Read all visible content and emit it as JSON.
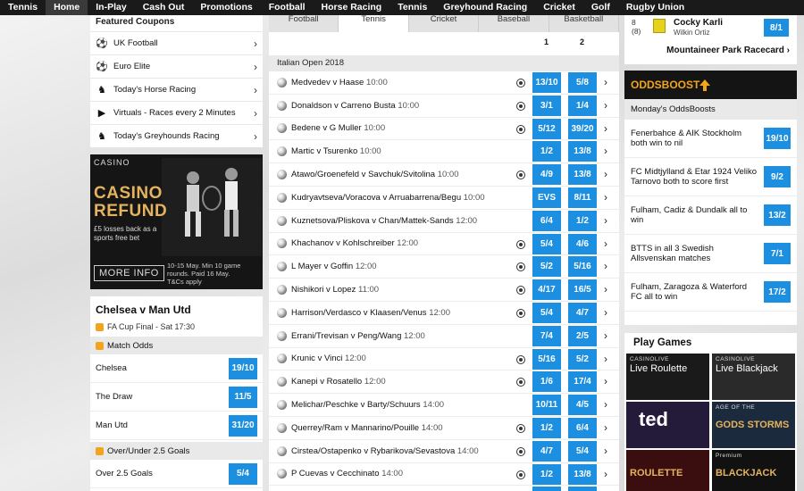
{
  "nav": [
    "Tennis",
    "Home",
    "In-Play",
    "Cash Out",
    "Promotions",
    "Football",
    "Horse Racing",
    "Tennis",
    "Greyhound Racing",
    "Cricket",
    "Golf",
    "Rugby Union"
  ],
  "nav_active": 1,
  "featured": {
    "title": "Featured Coupons",
    "items": [
      {
        "icon": "football-icon",
        "glyph": "⚽",
        "label": "UK Football"
      },
      {
        "icon": "football-icon",
        "glyph": "⚽",
        "label": "Euro Elite"
      },
      {
        "icon": "horse-icon",
        "glyph": "♞",
        "label": "Today's Horse Racing"
      },
      {
        "icon": "virtuals-icon",
        "glyph": "▶",
        "label": "Virtuals - Races every 2 Minutes"
      },
      {
        "icon": "greyhound-icon",
        "glyph": "♞",
        "label": "Today's Greyhounds Racing"
      }
    ]
  },
  "casino_promo": {
    "brand": "CASINO",
    "headline_1": "CASINO",
    "headline_2": "REFUND",
    "subtext": "£5 losses back as a sports free bet",
    "button": "MORE INFO",
    "terms": "10-15 May. Min 10 game rounds. Paid 16 May. T&Cs apply"
  },
  "match": {
    "title": "Chelsea v Man Utd",
    "subtitle": "FA Cup Final - Sat 17:30",
    "odds_title": "Match Odds",
    "rows": [
      {
        "name": "Chelsea",
        "odds": "19/10"
      },
      {
        "name": "The Draw",
        "odds": "11/5"
      },
      {
        "name": "Man Utd",
        "odds": "31/20"
      }
    ],
    "goals_title": "Over/Under 2.5 Goals",
    "goals_rows": [
      {
        "name": "Over 2.5 Goals",
        "odds": "5/4"
      }
    ]
  },
  "sport_tabs": [
    "Football",
    "Tennis",
    "Cricket",
    "Baseball",
    "Basketball"
  ],
  "sport_tab_active": 1,
  "col1": "1",
  "col2": "2",
  "league": "Italian Open 2018",
  "events": [
    {
      "name": "Medvedev v Haase",
      "time": "10:00",
      "live": true,
      "o1": "13/10",
      "o2": "5/8"
    },
    {
      "name": "Donaldson v Carreno Busta",
      "time": "10:00",
      "live": true,
      "o1": "3/1",
      "o2": "1/4"
    },
    {
      "name": "Bedene v G Muller",
      "time": "10:00",
      "live": true,
      "o1": "5/12",
      "o2": "39/20"
    },
    {
      "name": "Martic v Tsurenko",
      "time": "10:00",
      "live": false,
      "o1": "1/2",
      "o2": "13/8"
    },
    {
      "name": "Atawo/Groenefeld v Savchuk/Svitolina",
      "time": "10:00",
      "live": true,
      "o1": "4/9",
      "o2": "13/8"
    },
    {
      "name": "Kudryavtseva/Voracova v Arruabarrena/Begu",
      "time": "10:00",
      "live": false,
      "o1": "EVS",
      "o2": "8/11"
    },
    {
      "name": "Kuznetsova/Pliskova v Chan/Mattek-Sands",
      "time": "12:00",
      "live": false,
      "o1": "6/4",
      "o2": "1/2"
    },
    {
      "name": "Khachanov v Kohlschreiber",
      "time": "12:00",
      "live": true,
      "o1": "5/4",
      "o2": "4/6"
    },
    {
      "name": "L Mayer v Goffin",
      "time": "12:00",
      "live": true,
      "o1": "5/2",
      "o2": "5/16"
    },
    {
      "name": "Nishikori v Lopez",
      "time": "11:00",
      "live": true,
      "o1": "4/17",
      "o2": "16/5"
    },
    {
      "name": "Harrison/Verdasco v Klaasen/Venus",
      "time": "12:00",
      "live": true,
      "o1": "5/4",
      "o2": "4/7"
    },
    {
      "name": "Errani/Trevisan v Peng/Wang",
      "time": "12:00",
      "live": false,
      "o1": "7/4",
      "o2": "2/5"
    },
    {
      "name": "Krunic v Vinci",
      "time": "12:00",
      "live": true,
      "o1": "5/16",
      "o2": "5/2"
    },
    {
      "name": "Kanepi v Rosatello",
      "time": "12:00",
      "live": true,
      "o1": "1/6",
      "o2": "17/4"
    },
    {
      "name": "Melichar/Peschke v Barty/Schuurs",
      "time": "14:00",
      "live": false,
      "o1": "10/11",
      "o2": "4/5"
    },
    {
      "name": "Querrey/Ram v Mannarino/Pouille",
      "time": "14:00",
      "live": true,
      "o1": "1/2",
      "o2": "6/4"
    },
    {
      "name": "Cirstea/Ostapenko v Rybarikova/Sevastova",
      "time": "14:00",
      "live": true,
      "o1": "4/7",
      "o2": "5/4"
    },
    {
      "name": "P Cuevas v Cecchinato",
      "time": "14:00",
      "live": true,
      "o1": "1/2",
      "o2": "13/8"
    },
    {
      "name": "",
      "time": "",
      "live": false,
      "o1": "",
      "o2": ""
    }
  ],
  "race": {
    "number": "8",
    "draw": "(8)",
    "horse": "Cocky Karli",
    "jockey": "Wilkin Ortiz",
    "odds": "8/1",
    "link": "Mountaineer Park Racecard"
  },
  "oddsboost": {
    "t1": "ODDS",
    "t2": "BOOST",
    "subtitle": "Monday's OddsBoosts",
    "items": [
      {
        "desc": "Fenerbahce & AIK Stockholm both win to nil",
        "odds": "19/10"
      },
      {
        "desc": "FC Midtjylland & Etar 1924 Veliko Tarnovo both to score first",
        "odds": "9/2"
      },
      {
        "desc": "Fulham, Cadiz & Dundalk all to win",
        "odds": "13/2"
      },
      {
        "desc": "BTTS in all 3 Swedish Allsvenskan matches",
        "odds": "7/1"
      },
      {
        "desc": "Fulham, Zaragoza & Waterford FC all to win",
        "odds": "17/2"
      }
    ]
  },
  "play_games": {
    "title": "Play Games",
    "tiles": [
      {
        "small": "CASINOLIVE",
        "big": "Live Roulette",
        "bg": "#1a1a1a"
      },
      {
        "small": "CASINOLIVE",
        "big": "Live Blackjack",
        "bg": "#2a2a2a"
      },
      {
        "small": "",
        "big": "ted",
        "bg": "#241a3a"
      },
      {
        "small": "AGE OF THE",
        "big": "GODS STORMS",
        "bg": "#1c2a3d"
      },
      {
        "small": "",
        "big": "ROULETTE",
        "bg": "#3a0e0e"
      },
      {
        "small": "Premium",
        "big": "BLACKJACK",
        "bg": "#111111"
      }
    ]
  },
  "colors": {
    "odds": "#1d8fe0",
    "nav": "#1a1a1a",
    "boost": "#f2a51c",
    "casino_gold": "#e4b35d"
  }
}
